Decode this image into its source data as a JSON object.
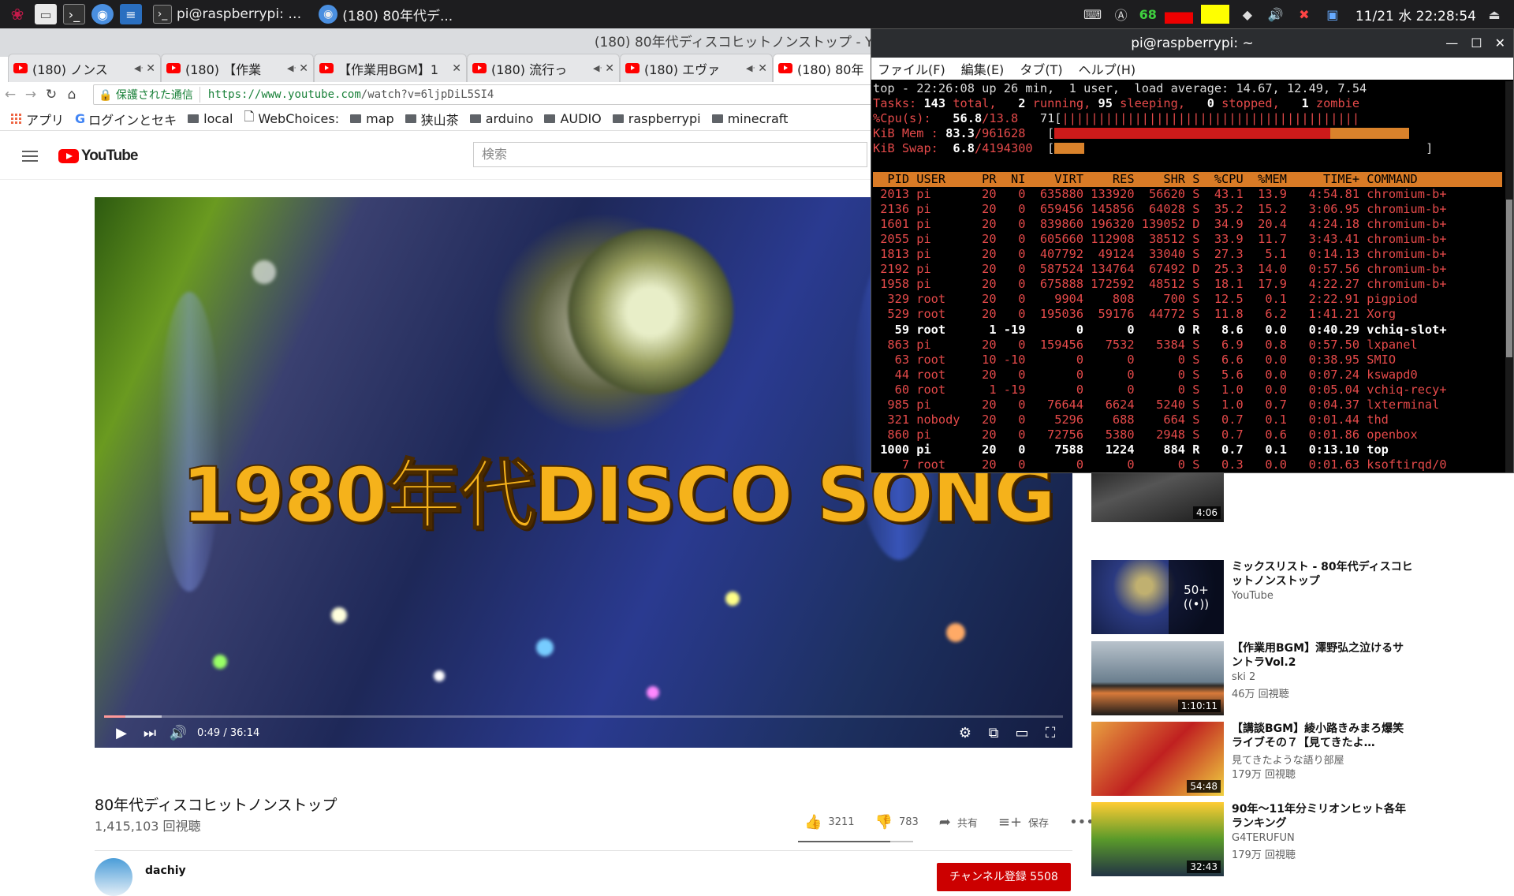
{
  "panel": {
    "tasks": [
      {
        "label": "pi@raspberrypi: …"
      },
      {
        "label": "(180) 80年代デ..."
      }
    ],
    "battery_value": "68",
    "clock": "11/21 水 22:28:54"
  },
  "browser": {
    "window_title": "(180) 80年代ディスコヒットノンストップ - YouTube",
    "tabs": [
      {
        "label": "(180) ノンス"
      },
      {
        "label": "(180) 【作業"
      },
      {
        "label": "【作業用BGM】1"
      },
      {
        "label": "(180) 流行っ"
      },
      {
        "label": "(180) エヴァ"
      },
      {
        "label": "(180) 80年"
      }
    ],
    "secure_label": "保護された通信",
    "url_host": "https://www.youtube.com",
    "url_rest": "/watch?v=6ljpDiL5SI4",
    "bookmarks": [
      {
        "label": "アプリ",
        "icon": "apps-icon"
      },
      {
        "label": "ログインとセキ",
        "icon": "google-icon"
      },
      {
        "label": "local",
        "icon": "folder-icon"
      },
      {
        "label": "WebChoices:",
        "icon": "page-icon"
      },
      {
        "label": "map",
        "icon": "folder-icon"
      },
      {
        "label": "狭山茶",
        "icon": "folder-icon"
      },
      {
        "label": "arduino",
        "icon": "folder-icon"
      },
      {
        "label": "AUDIO",
        "icon": "folder-icon"
      },
      {
        "label": "raspberrypi",
        "icon": "folder-icon"
      },
      {
        "label": "minecraft",
        "icon": "folder-icon"
      }
    ]
  },
  "youtube": {
    "logo": "YouTube",
    "search_placeholder": "検索",
    "video_overlay_text": "1980年代DISCO SONG",
    "time": "0:49 / 36:14",
    "progress_fraction": 0.0226,
    "video_title": "80年代ディスコヒットノンストップ",
    "views": "1,415,103 回視聴",
    "likes": "3211",
    "dislikes": "783",
    "share": "共有",
    "save": "保存",
    "channel": "dachiy",
    "subscribe": "チャンネル登録 5508",
    "sidebar": [
      {
        "title": "",
        "channel": "",
        "meta": "",
        "duration": "4:06"
      },
      {
        "title": "ミックスリスト - 80年代ディスコヒットノンストップ",
        "channel": "YouTube",
        "meta": "",
        "duration": "",
        "overlay": "50+"
      },
      {
        "title": "【作業用BGM】澤野弘之泣けるサントラVol.2",
        "channel": "ski 2",
        "meta": "46万 回視聴",
        "duration": "1:10:11"
      },
      {
        "title": "【講談BGM】綾小路きみまろ爆笑ライブその７【見てきたよ…",
        "channel": "見てきたような語り部屋",
        "meta": "179万 回視聴",
        "duration": "54:48"
      },
      {
        "title": "90年〜11年分ミリオンヒット各年ランキング",
        "channel": "G4TERUFUN",
        "meta": "179万 回視聴",
        "duration": "32:43"
      }
    ]
  },
  "terminal": {
    "title": "pi@raspberrypi: ~",
    "menu": [
      "ファイル(F)",
      "編集(E)",
      "タブ(T)",
      "ヘルプ(H)"
    ],
    "summary_line": "top - 22:26:08 up 26 min,  1 user,  load average: 14.67, 12.49, 7.54",
    "tasks": {
      "total": "143",
      "running": "2",
      "sleeping": "95",
      "stopped": "0",
      "zombie": "1"
    },
    "cpu": {
      "us": "56.8",
      "sy": "13.8",
      "total": "71"
    },
    "mem": {
      "pct": "83.3",
      "total": "961628"
    },
    "swap": {
      "pct": "6.8",
      "total": "4194300"
    },
    "columns": [
      "PID",
      "USER",
      "PR",
      "NI",
      "VIRT",
      "RES",
      "SHR",
      "S",
      "%CPU",
      "%MEM",
      "TIME+",
      "COMMAND"
    ],
    "processes": [
      [
        "2013",
        "pi",
        "20",
        "0",
        "635880",
        "133920",
        "56620",
        "S",
        "43.1",
        "13.9",
        "4:54.81",
        "chromium-b+"
      ],
      [
        "2136",
        "pi",
        "20",
        "0",
        "659456",
        "145856",
        "64028",
        "S",
        "35.2",
        "15.2",
        "3:06.95",
        "chromium-b+"
      ],
      [
        "1601",
        "pi",
        "20",
        "0",
        "839860",
        "196320",
        "139052",
        "D",
        "34.9",
        "20.4",
        "4:24.18",
        "chromium-b+"
      ],
      [
        "2055",
        "pi",
        "20",
        "0",
        "605660",
        "112908",
        "38512",
        "S",
        "33.9",
        "11.7",
        "3:43.41",
        "chromium-b+"
      ],
      [
        "1813",
        "pi",
        "20",
        "0",
        "407792",
        "49124",
        "33040",
        "S",
        "27.3",
        "5.1",
        "0:14.13",
        "chromium-b+"
      ],
      [
        "2192",
        "pi",
        "20",
        "0",
        "587524",
        "134764",
        "67492",
        "D",
        "25.3",
        "14.0",
        "0:57.56",
        "chromium-b+"
      ],
      [
        "1958",
        "pi",
        "20",
        "0",
        "675888",
        "172592",
        "48512",
        "S",
        "18.1",
        "17.9",
        "4:22.27",
        "chromium-b+"
      ],
      [
        "329",
        "root",
        "20",
        "0",
        "9904",
        "808",
        "700",
        "S",
        "12.5",
        "0.1",
        "2:22.91",
        "pigpiod"
      ],
      [
        "529",
        "root",
        "20",
        "0",
        "195036",
        "59176",
        "44772",
        "S",
        "11.8",
        "6.2",
        "1:41.21",
        "Xorg"
      ],
      [
        "59",
        "root",
        "1",
        "-19",
        "0",
        "0",
        "0",
        "R",
        "8.6",
        "0.0",
        "0:40.29",
        "vchiq-slot+"
      ],
      [
        "863",
        "pi",
        "20",
        "0",
        "159456",
        "7532",
        "5384",
        "S",
        "6.9",
        "0.8",
        "0:57.50",
        "lxpanel"
      ],
      [
        "63",
        "root",
        "10",
        "-10",
        "0",
        "0",
        "0",
        "S",
        "6.6",
        "0.0",
        "0:38.95",
        "SMIO"
      ],
      [
        "44",
        "root",
        "20",
        "0",
        "0",
        "0",
        "0",
        "S",
        "5.6",
        "0.0",
        "0:07.24",
        "kswapd0"
      ],
      [
        "60",
        "root",
        "1",
        "-19",
        "0",
        "0",
        "0",
        "S",
        "1.0",
        "0.0",
        "0:05.04",
        "vchiq-recy+"
      ],
      [
        "985",
        "pi",
        "20",
        "0",
        "76644",
        "6624",
        "5240",
        "S",
        "1.0",
        "0.7",
        "0:04.37",
        "lxterminal"
      ],
      [
        "321",
        "nobody",
        "20",
        "0",
        "5296",
        "688",
        "664",
        "S",
        "0.7",
        "0.1",
        "0:01.44",
        "thd"
      ],
      [
        "860",
        "pi",
        "20",
        "0",
        "72756",
        "5380",
        "2948",
        "S",
        "0.7",
        "0.6",
        "0:01.86",
        "openbox"
      ],
      [
        "1000",
        "pi",
        "20",
        "0",
        "7588",
        "1224",
        "884",
        "R",
        "0.7",
        "0.1",
        "0:13.10",
        "top"
      ],
      [
        "7",
        "root",
        "20",
        "0",
        "0",
        "0",
        "0",
        "S",
        "0.3",
        "0.0",
        "0:01.63",
        "ksoftirqd/0"
      ]
    ]
  }
}
